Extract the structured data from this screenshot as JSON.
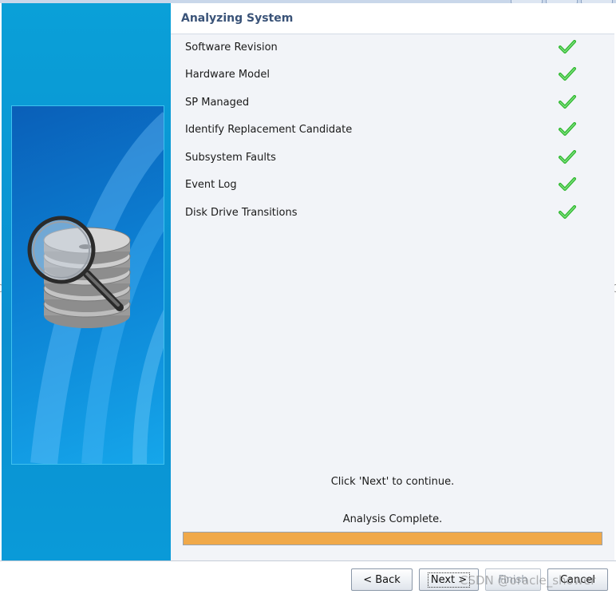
{
  "header": {
    "title": "Analyzing System"
  },
  "checklist": [
    {
      "label": "Software Revision",
      "status_icon": "green-check-icon"
    },
    {
      "label": "Hardware Model",
      "status_icon": "green-check-icon"
    },
    {
      "label": "SP Managed",
      "status_icon": "green-check-icon"
    },
    {
      "label": "Identify Replacement Candidate",
      "status_icon": "green-check-icon"
    },
    {
      "label": "Subsystem Faults",
      "status_icon": "green-check-icon"
    },
    {
      "label": "Event Log",
      "status_icon": "green-check-icon"
    },
    {
      "label": "Disk Drive Transitions",
      "status_icon": "green-check-icon"
    }
  ],
  "instruction": "Click 'Next' to continue.",
  "status": "Analysis Complete.",
  "progress": {
    "value": 1.0
  },
  "buttons": {
    "back": "< Back",
    "next": "Next >",
    "finish": "Finish",
    "cancel": "Cancel"
  },
  "watermark": "CSDN @oracle_shower",
  "colors": {
    "accent_title": "#3a5378",
    "progress_fill": "#f0a94a",
    "side_panel": "#0b8fd0",
    "check_green": "#2fb82f"
  },
  "side_panel_icon": "magnifier-over-disk-stack-icon"
}
